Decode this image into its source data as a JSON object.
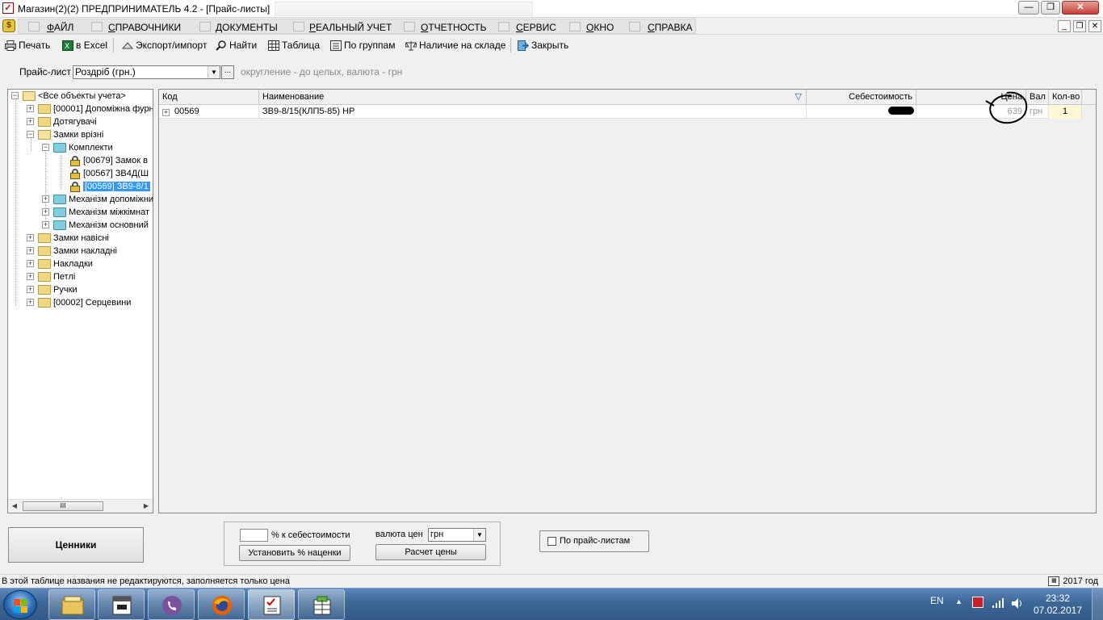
{
  "window": {
    "title": "Магазин(2)(2)  ПРЕДПРИНИМАТЕЛЬ 4.2 - [Прайс-листы]",
    "controls": {
      "minimize": "—",
      "maximize": "❐",
      "close": "✕"
    }
  },
  "menu": {
    "items": [
      {
        "mnemonic": "Ф",
        "rest": "АЙЛ"
      },
      {
        "mnemonic": "С",
        "rest": "ПРАВОЧНИКИ"
      },
      {
        "mnemonic": "Д",
        "rest": "ОКУМЕНТЫ"
      },
      {
        "mnemonic": "Р",
        "rest": "ЕАЛЬНЫЙ УЧЕТ"
      },
      {
        "mnemonic": "О",
        "rest": "ТЧЕТНОСТЬ"
      },
      {
        "mnemonic": "С",
        "rest": "ЕРВИС"
      },
      {
        "mnemonic": "О",
        "rest": "КНО"
      },
      {
        "mnemonic": "С",
        "rest": "ПРАВКА"
      }
    ],
    "mdi_controls": {
      "minimize": "_",
      "restore": "❐",
      "close": "✕"
    }
  },
  "toolbar": {
    "print": "Печать",
    "excel": "в Excel",
    "export": "Экспорт/импорт",
    "find": "Найти",
    "table": "Таблица",
    "groups": "По группам",
    "stock": "Наличие на складе",
    "close": "Закрыть"
  },
  "price_list": {
    "label": "Прайс-лист",
    "value": "Роздріб (грн.)",
    "dots": "...",
    "note": "округление - до целых, валюта - грн"
  },
  "tree": {
    "root": "<Все объекты учета>",
    "nodes": [
      {
        "label": "[00001]  Допоміжна фурн"
      },
      {
        "label": "Дотягувачі"
      },
      {
        "label": "Замки врізні"
      },
      {
        "label": "Комплекти"
      },
      {
        "label": "[00679]  Замок в"
      },
      {
        "label": "[00567]  ЗВ4Д(Ш"
      },
      {
        "label": "[00569]  ЗВ9-8/1"
      },
      {
        "label": "Механізм допоміжни"
      },
      {
        "label": "Механізм міжкімнат"
      },
      {
        "label": "Механізм основний"
      },
      {
        "label": "Замки навісні"
      },
      {
        "label": "Замки накладні"
      },
      {
        "label": "Накладки"
      },
      {
        "label": "Петлі"
      },
      {
        "label": "Ручки"
      },
      {
        "label": "[00002]  Серцевини"
      }
    ],
    "scroll_thumb": "III"
  },
  "grid": {
    "columns": {
      "code": "Код",
      "name": "Наименование",
      "cost": "Себестоимость",
      "price": "Цена",
      "currency": "Вал",
      "qty": "Кол-во"
    },
    "rows": [
      {
        "code": "00569",
        "name": "ЗВ9-8/15(КЛП5-85) НР",
        "cost": "",
        "price": "639",
        "currency": "грн",
        "qty": "1"
      }
    ]
  },
  "bottom": {
    "price_tags": "Ценники",
    "percent_label": "% к себестоимости",
    "currency_label": "валюта цен",
    "currency_value": "грн",
    "set_markup": "Установить % наценки",
    "calc_price": "Расчет цены",
    "by_price_lists": "По прайс-листам"
  },
  "status": {
    "text": "В этой таблице названия не редактируются, заполняется только цена",
    "year": "2017 год"
  },
  "taskbar": {
    "lang": "EN",
    "time": "23:32",
    "date": "07.02.2017"
  },
  "colors": {
    "selection": "#3399ff",
    "taskbar": "#3c6796"
  }
}
